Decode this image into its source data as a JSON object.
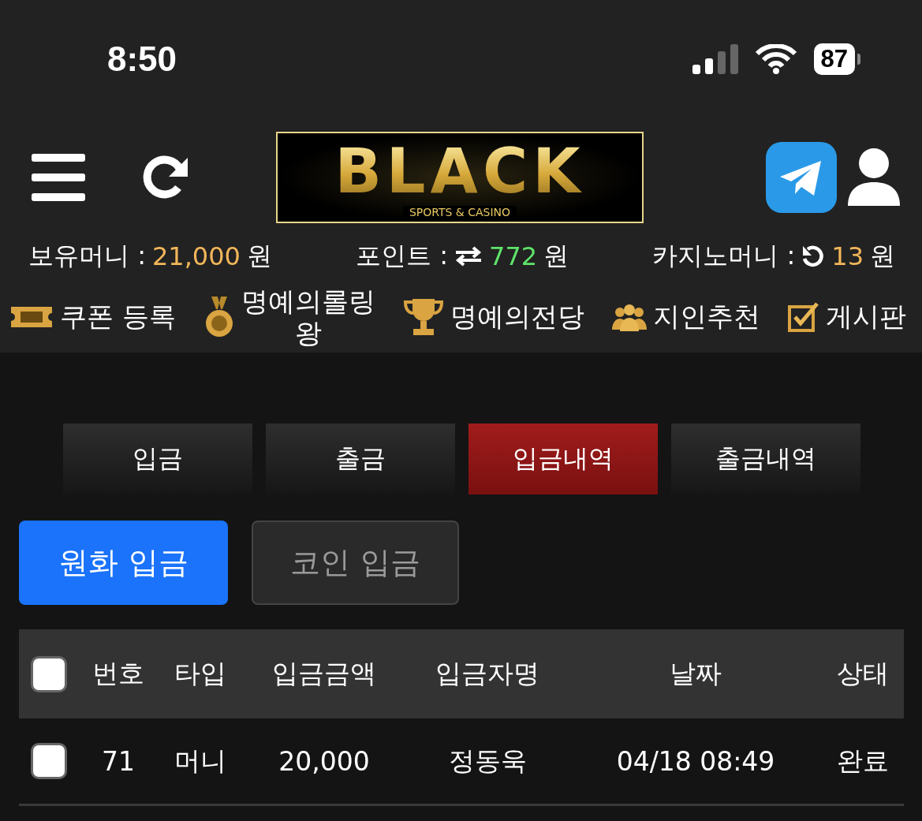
{
  "status_bar": {
    "time": "8:50",
    "battery": "87"
  },
  "header": {
    "logo_title": "BLACK",
    "logo_subtitle": "SPORTS & CASINO"
  },
  "balances": [
    {
      "kind": "money",
      "label": "보유머니 :",
      "value": "21,000",
      "unit": "원",
      "color": "#f2b75a"
    },
    {
      "kind": "points",
      "label": "포인트 :",
      "value": "772",
      "unit": "원",
      "color": "#5fe36b"
    },
    {
      "kind": "casino",
      "label": "카지노머니 :",
      "value": "13",
      "unit": "원",
      "color": "#f2b75a"
    }
  ],
  "menu": [
    {
      "kind": "coupon",
      "label": "쿠폰 등록"
    },
    {
      "kind": "medal",
      "label": "명예의롤링왕"
    },
    {
      "kind": "trophy",
      "label": "명예의전당"
    },
    {
      "kind": "people",
      "label": "지인추천"
    },
    {
      "kind": "board",
      "label": "게시판"
    }
  ],
  "tabs": [
    {
      "label": "입금",
      "selected": false
    },
    {
      "label": "출금",
      "selected": false
    },
    {
      "label": "입금내역",
      "selected": true
    },
    {
      "label": "출금내역",
      "selected": false
    }
  ],
  "deposit_types": [
    {
      "label": "원화 입금",
      "selected": true
    },
    {
      "label": "코인 입금",
      "selected": false
    }
  ],
  "table": {
    "select_all_checked": false,
    "columns": [
      "번호",
      "타입",
      "입금금액",
      "입금자명",
      "날짜",
      "상태"
    ],
    "rows": [
      {
        "checked": false,
        "cells": [
          "71",
          "머니",
          "20,000",
          "정동욱",
          "04/18 08:49",
          "완료"
        ]
      }
    ]
  }
}
